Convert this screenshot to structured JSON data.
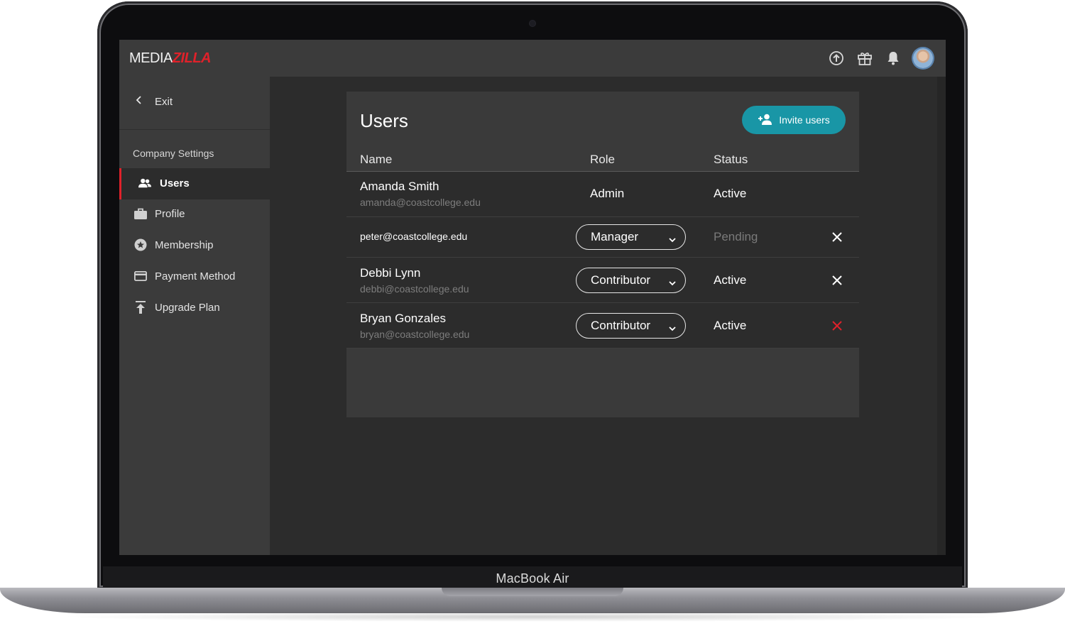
{
  "device": {
    "label": "MacBook Air"
  },
  "app": {
    "logo": {
      "part1": "MEDIA",
      "part2": "ZILLA"
    },
    "top_icons": [
      "upload-circle-icon",
      "gift-icon",
      "bell-icon",
      "avatar"
    ]
  },
  "sidebar": {
    "exit_label": "Exit",
    "section_title": "Company Settings",
    "items": [
      {
        "label": "Users",
        "icon": "users-icon",
        "active": true
      },
      {
        "label": "Profile",
        "icon": "briefcase-icon"
      },
      {
        "label": "Membership",
        "icon": "star-circle-icon"
      },
      {
        "label": "Payment Method",
        "icon": "credit-card-icon"
      },
      {
        "label": "Upgrade Plan",
        "icon": "upgrade-arrow-icon"
      }
    ]
  },
  "main": {
    "title": "Users",
    "invite_label": "Invite users",
    "columns": {
      "name": "Name",
      "role": "Role",
      "status": "Status"
    },
    "rows": [
      {
        "name": "Amanda Smith",
        "email": "amanda@coastcollege.edu",
        "role": "Admin",
        "status": "Active"
      },
      {
        "name": "",
        "email": "peter@coastcollege.edu",
        "role": "Manager",
        "status": "Pending"
      },
      {
        "name": "Debbi Lynn",
        "email": "debbi@coastcollege.edu",
        "role": "Contributor",
        "status": "Active"
      },
      {
        "name": "Bryan Gonzales",
        "email": "bryan@coastcollege.edu",
        "role": "Contributor",
        "status": "Active"
      }
    ]
  },
  "colors": {
    "accent_red": "#e0212a",
    "invite_teal": "#1996a6",
    "surface": "#3a3a3a",
    "background": "#2c2c2c"
  }
}
